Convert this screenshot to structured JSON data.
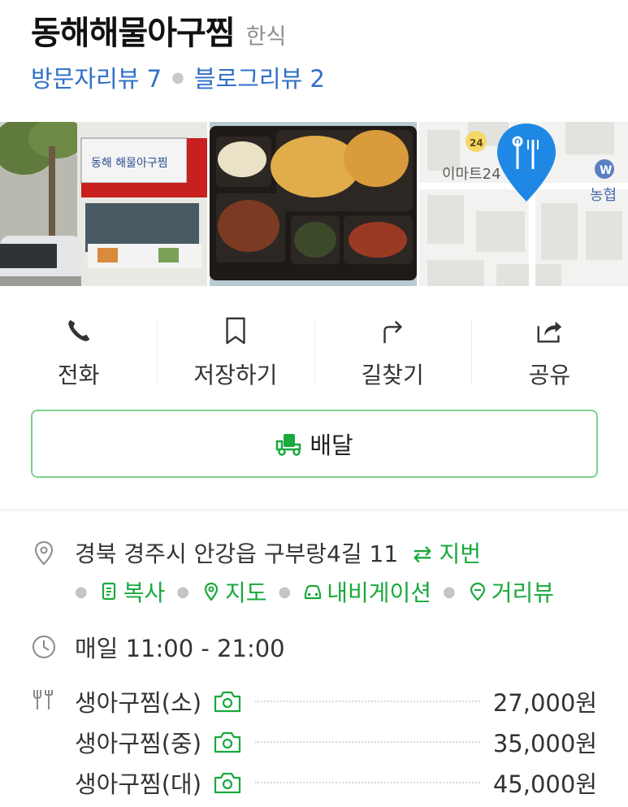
{
  "place": {
    "name": "동해해물아구찜",
    "category": "한식",
    "visitor_reviews": "방문자리뷰 7",
    "blog_reviews": "블로그리뷰 2"
  },
  "photos": {
    "storefront_sign": "동해 해물아구찜",
    "map_label_emart": "이마트24",
    "map_badge_24": "24",
    "map_label_bank": "농협"
  },
  "actions": [
    {
      "label": "전화",
      "icon": "phone-icon"
    },
    {
      "label": "저장하기",
      "icon": "bookmark-icon"
    },
    {
      "label": "길찾기",
      "icon": "directions-icon"
    },
    {
      "label": "공유",
      "icon": "share-icon"
    }
  ],
  "delivery": {
    "label": "배달",
    "icon": "delivery-truck-icon"
  },
  "address": {
    "text": "경북 경주시 안강읍 구부랑4길 11",
    "jibun": "⇄ 지번",
    "links": [
      {
        "label": "복사",
        "icon": "copy-icon"
      },
      {
        "label": "지도",
        "icon": "map-pin-icon"
      },
      {
        "label": "내비게이션",
        "icon": "car-icon"
      },
      {
        "label": "거리뷰",
        "icon": "street-view-icon"
      }
    ]
  },
  "hours": "매일 11:00 - 21:00",
  "menu": [
    {
      "name": "생아구찜(소)",
      "price": "27,000원"
    },
    {
      "name": "생아구찜(중)",
      "price": "35,000원"
    },
    {
      "name": "생아구찜(대)",
      "price": "45,000원"
    }
  ],
  "colors": {
    "link_blue": "#2f6fc6",
    "naver_green": "#19a93c",
    "delivery_border": "#7fd08e",
    "map_pin": "#1f88e5"
  }
}
